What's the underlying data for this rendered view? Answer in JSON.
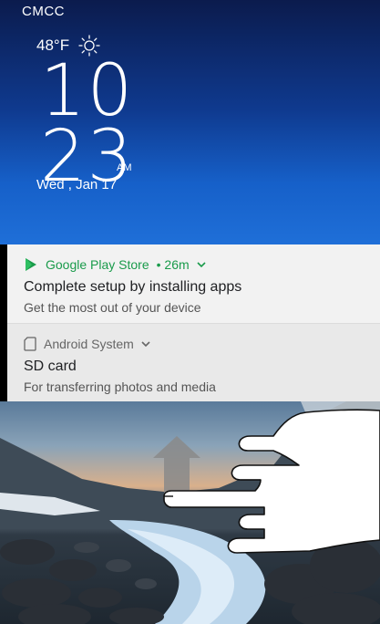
{
  "status_bar": {
    "carrier": "CMCC"
  },
  "weather": {
    "temperature": "48°F",
    "icon": "sun-icon"
  },
  "clock": {
    "hours": "10",
    "minutes": "23",
    "ampm": "AM",
    "date": "Wed , Jan 17"
  },
  "notifications": [
    {
      "app": "Google Play Store",
      "time": "• 26m",
      "icon": "play-store-icon",
      "title": "Complete setup by installing apps",
      "body": "Get the most out of your device",
      "accent": "#1a9b4b"
    },
    {
      "app": "Android System",
      "icon": "sd-card-icon",
      "title": "SD card",
      "body": "For transferring photos and media",
      "accent": "#666666"
    }
  ],
  "gesture": {
    "icon": "swipe-up-hand-icon"
  }
}
